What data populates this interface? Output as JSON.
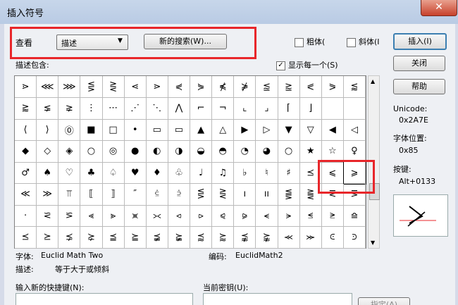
{
  "window": {
    "title": "插入符号",
    "close_label": "✕"
  },
  "view": {
    "label": "查看",
    "select_value": "描述",
    "new_search_label": "新的搜索(W)..."
  },
  "options": {
    "bold_label": "粗体(",
    "italic_label": "斜体(I",
    "show_each_label": "显示每一个(S)"
  },
  "describe_contains_label": "描述包含:",
  "buttons": {
    "insert": "插入(I)",
    "close": "关闭",
    "help": "帮助"
  },
  "unicode": {
    "label": "Unicode:",
    "value": "0x2A7E"
  },
  "char_pos": {
    "label": "字体位置:",
    "value": "0x85"
  },
  "keys": {
    "label": "按键:",
    "value": "Alt+0133"
  },
  "font": {
    "label": "字体:",
    "value": "Euclid Math Two"
  },
  "encoding": {
    "label": "编码:",
    "value": "EuclidMath2"
  },
  "description": {
    "label": "描述:",
    "value": "等于大于或倾斜"
  },
  "new_shortcut_label": "输入新的快捷键(N):",
  "current_key_label": "当前密钥(U):",
  "bottom_btn_label": "指定(A)",
  "grid": [
    [
      "⋗",
      "⋘",
      "⋙",
      "⋚",
      "⋛",
      "⋖",
      "⋗",
      "⋞",
      "⋟",
      "⋠",
      "⋡",
      "⪍",
      "⪎",
      "⪕",
      "⪖",
      "⪅"
    ],
    [
      "⪆",
      "⪇",
      "⪈",
      "⋮",
      "⋯",
      "⋰",
      "⋱",
      "⋀",
      "⌐",
      "¬",
      "⌞",
      "⌟",
      "⌈",
      "⌋",
      "",
      ""
    ],
    [
      "⟨",
      "⟩",
      "⓪",
      "■",
      "□",
      "•",
      "▭",
      "▭",
      "▲",
      "△",
      "▶",
      "▷",
      "▼",
      "▽",
      "◀",
      "◁"
    ],
    [
      "◆",
      "◇",
      "◈",
      "○",
      "◎",
      "●",
      "◐",
      "◑",
      "◒",
      "◓",
      "◔",
      "◕",
      "○",
      "★",
      "☆",
      "♀"
    ],
    [
      "♂",
      "♠",
      "♡",
      "♣",
      "♤",
      "♥",
      "♦",
      "♧",
      "♩",
      "♫",
      "♭",
      "♮",
      "♯",
      "⪯",
      "⩽",
      "⩾"
    ],
    [
      "≪",
      "≫",
      "⫪",
      "⟦",
      "⟧",
      "″",
      "⫃",
      "⫄",
      "⋚",
      "⋛",
      "ı",
      "ıı",
      "⪋",
      "⪌",
      "⪙",
      "⪚"
    ],
    [
      "·",
      "⪝",
      "⪞",
      "⪡",
      "⪢",
      "⪤",
      "⪥",
      "⪦",
      "⪧",
      "⪨",
      "⪩",
      "⪪",
      "⪫",
      "⪬",
      "⪭",
      "⪮"
    ],
    [
      "⪯",
      "⪰",
      "⪱",
      "⪲",
      "⪳",
      "⪴",
      "⪵",
      "⪶",
      "⪷",
      "⪸",
      "⪹",
      "⪺",
      "⪻",
      "⪼",
      "⪽",
      "⪾"
    ]
  ]
}
